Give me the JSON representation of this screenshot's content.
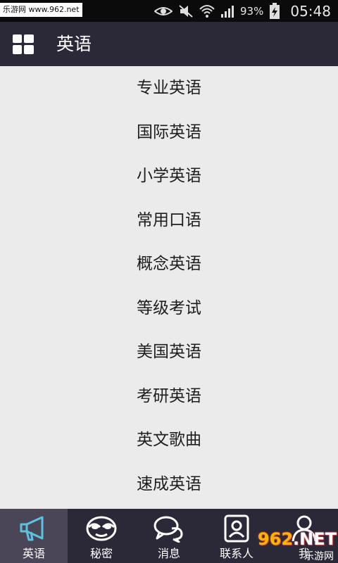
{
  "status_bar": {
    "watermark_text": "乐游网 www.962.net",
    "battery_percent": "93%",
    "time": "05:48",
    "icons": [
      "eye-icon",
      "mute-icon",
      "wifi-icon",
      "signal-icon",
      "battery-charging-icon"
    ]
  },
  "header": {
    "menu_icon": "grid-icon",
    "title": "英语"
  },
  "list": {
    "items": [
      {
        "label": "专业英语"
      },
      {
        "label": "国际英语"
      },
      {
        "label": "小学英语"
      },
      {
        "label": "常用口语"
      },
      {
        "label": "概念英语"
      },
      {
        "label": "等级考试"
      },
      {
        "label": "美国英语"
      },
      {
        "label": "考研英语"
      },
      {
        "label": "英文歌曲"
      },
      {
        "label": "速成英语"
      }
    ]
  },
  "bottom_nav": {
    "active_index": 0,
    "items": [
      {
        "label": "英语",
        "icon": "megaphone-icon"
      },
      {
        "label": "秘密",
        "icon": "mask-icon"
      },
      {
        "label": "消息",
        "icon": "chat-bubbles-icon"
      },
      {
        "label": "联系人",
        "icon": "contacts-icon"
      },
      {
        "label": "我",
        "icon": "person-icon"
      }
    ]
  },
  "watermark": {
    "logo": "962",
    "logo_suffix": ".NET",
    "subtitle": "乐游网"
  },
  "colors": {
    "status_bar": "#0b0b0b",
    "app_bar": "#2b2838",
    "list_background": "#ebebeb",
    "active_tab": "#4a4658",
    "active_icon": "#5bc3df"
  }
}
